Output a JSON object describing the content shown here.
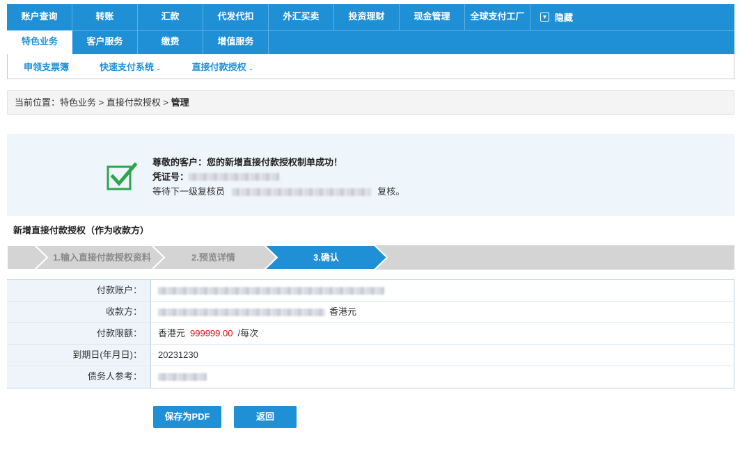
{
  "nav": {
    "primary": [
      "账户查询",
      "转账",
      "汇款",
      "代发代扣",
      "外汇买卖",
      "投资理财",
      "现金管理",
      "全球支付工厂"
    ],
    "hide_label": "隐藏",
    "secondary": [
      "特色业务",
      "客户服务",
      "缴费",
      "增值服务"
    ],
    "sub": [
      "申领支票簿",
      "快速支付系统",
      "直接付款授权"
    ]
  },
  "breadcrumb": {
    "prefix": "当前位置：特色业务 > 直接付款授权 > ",
    "current": "管理"
  },
  "success": {
    "title": "尊敬的客户：您的新增直接付款授权制单成功！",
    "voucher_label": "凭证号：",
    "review_prefix": "等待下一级复核员",
    "review_suffix": "复核。"
  },
  "section_title": "新增直接付款授权（作为收款方）",
  "steps": [
    "1.输入直接付款授权资料",
    "2.预览详情",
    "3.确认"
  ],
  "form": {
    "labels": [
      "付款账户：",
      "收款方：",
      "付款限额：",
      "到期日(年月日)：",
      "债务人参考："
    ],
    "payee_currency": "香港元",
    "limit_currency": "香港元",
    "limit_amount": "999999.00",
    "limit_unit": "/每次",
    "expiry": "20231230"
  },
  "buttons": {
    "save_pdf": "保存为PDF",
    "back": "返回"
  },
  "colors": {
    "brand": "#1f8fd6",
    "success_green": "#2ea44f",
    "amount_red": "#e60012"
  }
}
